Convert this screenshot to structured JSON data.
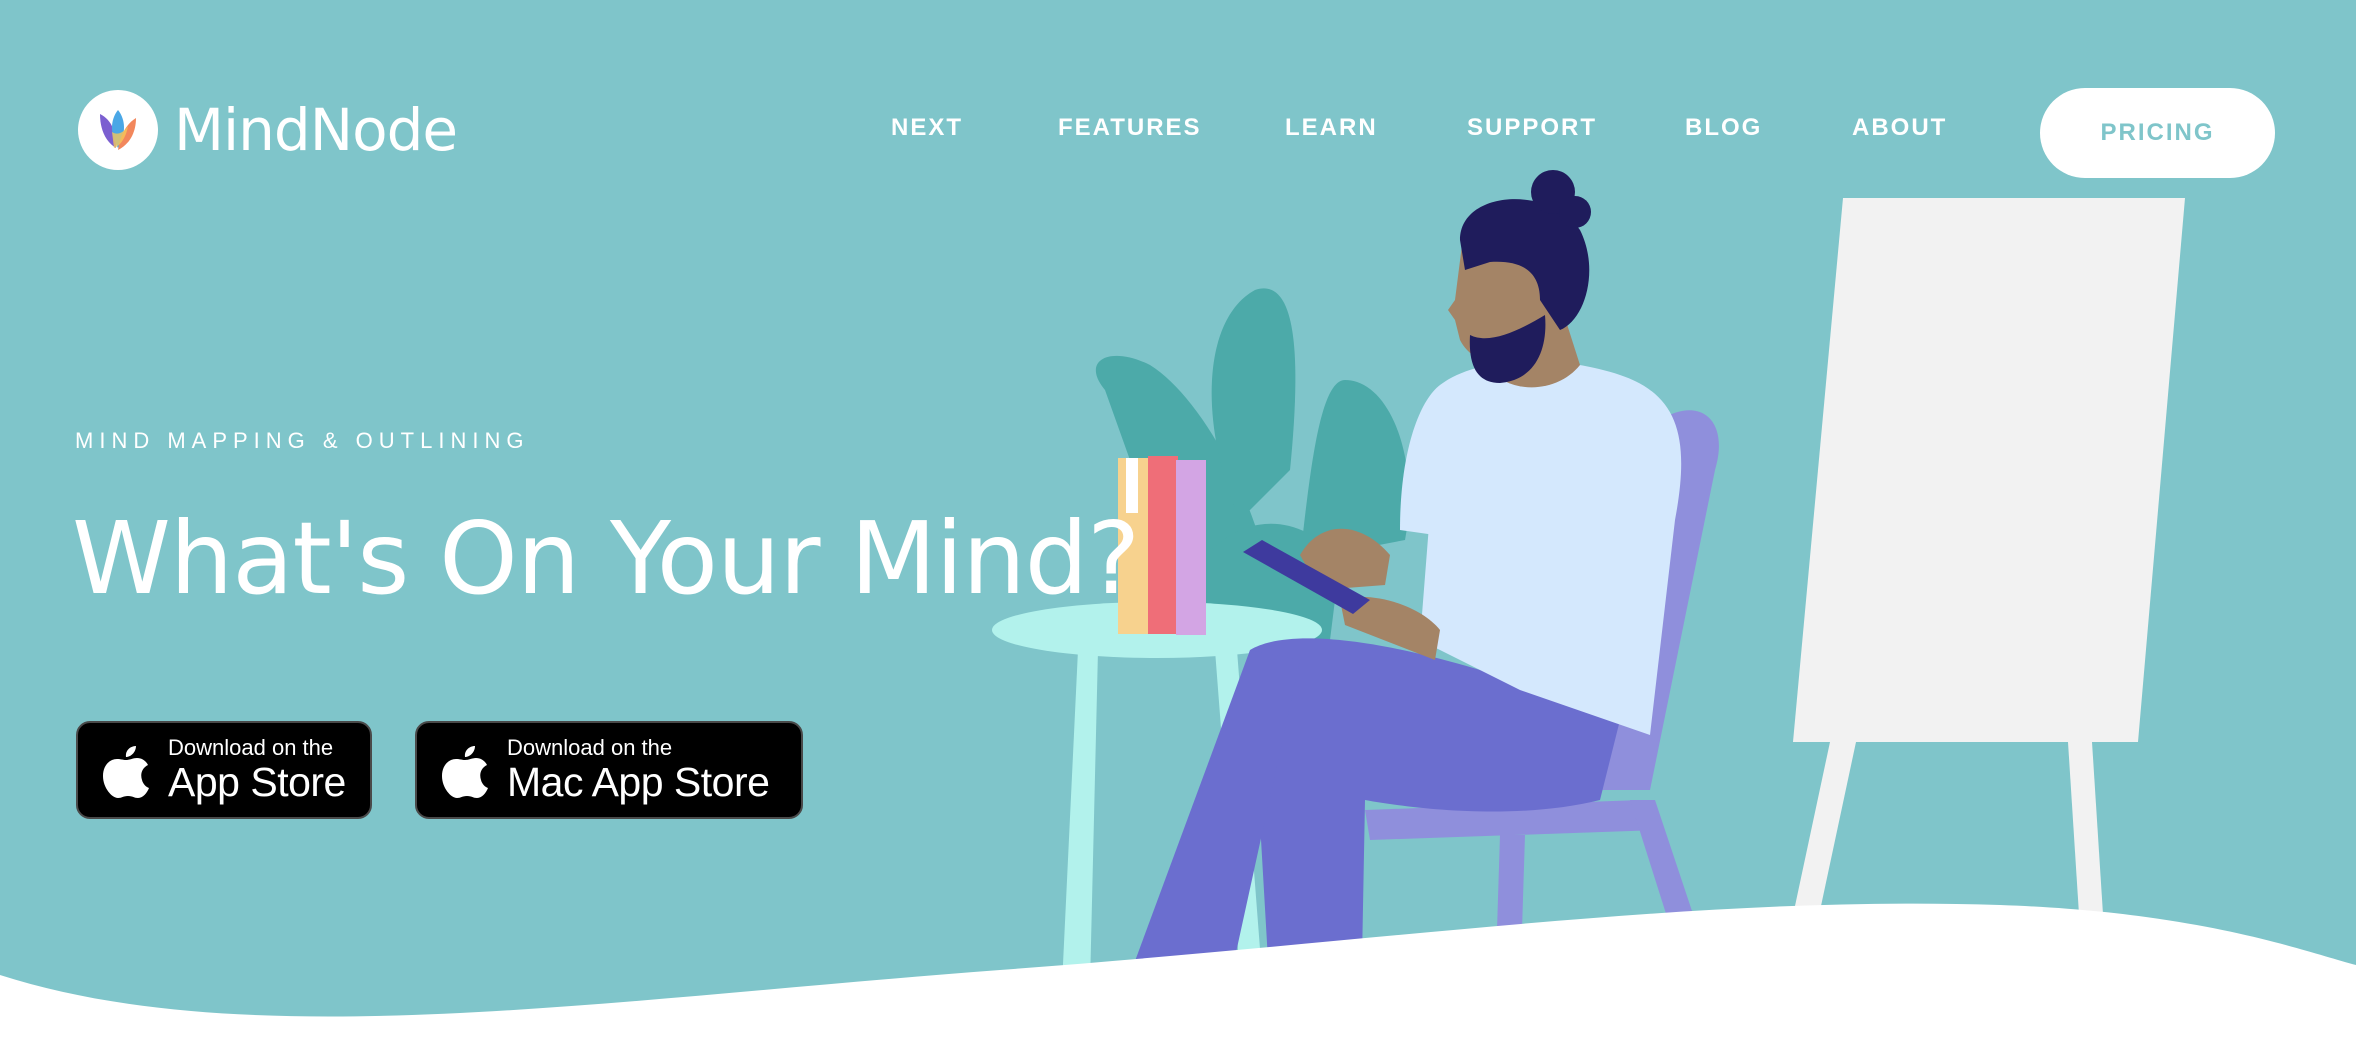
{
  "brand": {
    "name": "MindNode",
    "logo_icon": "mindnode-leaf-logo"
  },
  "nav": {
    "items": [
      {
        "label": "NEXT"
      },
      {
        "label": "FEATURES"
      },
      {
        "label": "LEARN"
      },
      {
        "label": "SUPPORT"
      },
      {
        "label": "BLOG"
      },
      {
        "label": "ABOUT"
      }
    ],
    "cta_label": "PRICING"
  },
  "hero": {
    "eyebrow": "MIND MAPPING & OUTLINING",
    "headline": "What's On Your Mind?"
  },
  "downloads": [
    {
      "small": "Download on the",
      "big": "App Store",
      "icon": "apple-icon"
    },
    {
      "small": "Download on the",
      "big": "Mac App Store",
      "icon": "apple-icon"
    }
  ],
  "colors": {
    "background": "#7fc5ca",
    "accent": "#ffffff",
    "button_bg": "#000000"
  }
}
